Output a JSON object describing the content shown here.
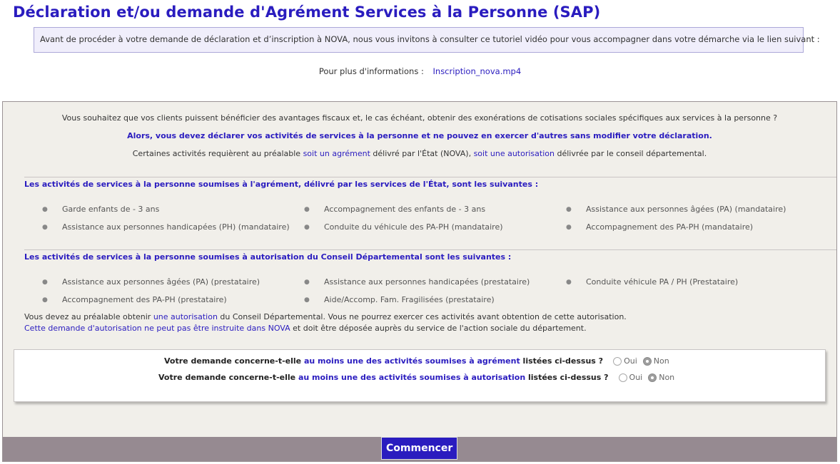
{
  "header": {
    "title": "Déclaration et/ou demande d'Agrément Services à la Personne (SAP)"
  },
  "tutorial": {
    "text": "Avant de procéder à votre demande de déclaration et d’inscription à NOVA, nous vous invitons à consulter ce tutoriel vidéo pour vous accompagner dans votre démarche via le lien suivant :"
  },
  "info": {
    "label": "Pour plus d'informations :",
    "link": "Inscription_nova.mp4"
  },
  "intro": {
    "line1": "Vous souhaitez que vos clients puissent bénéficier des avantages fiscaux et, le cas échéant, obtenir des exonérations de cotisations sociales spécifiques aux services à la personne ?",
    "line2": "Alors, vous devez déclarer vos activités de services à la personne et ne pouvez en exercer d'autres sans modifier votre déclaration.",
    "line3_a": "Certaines activités requièrent au préalable ",
    "line3_link1": "soit un agrément",
    "line3_b": " délivré par l'État (NOVA), ",
    "line3_link2": "soit une autorisation",
    "line3_c": " délivrée par le conseil départemental."
  },
  "agrement": {
    "title": "Les activités de services à la personne soumises à l'agrément, délivré par les services de l'État, sont les suivantes :",
    "items": [
      "Garde enfants de - 3 ans",
      "Accompagnement des enfants de - 3 ans",
      "Assistance aux personnes âgées (PA) (mandataire)",
      "Assistance aux personnes handicapées (PH) (mandataire)",
      "Conduite du véhicule des PA-PH (mandataire)",
      "Accompagnement des PA-PH (mandataire)"
    ]
  },
  "autorisation": {
    "title": "Les activités de services à la personne soumises à autorisation du Conseil Départemental sont les suivantes :",
    "items": [
      "Assistance aux personnes âgées (PA) (prestataire)",
      "Assistance aux personnes handicapées (prestataire)",
      "Conduite véhicule PA / PH (Prestataire)",
      "Accompagnement des PA-PH (prestataire)",
      "Aide/Accomp. Fam. Fragilisées (prestataire)"
    ],
    "note1_a": "Vous devez au préalable obtenir ",
    "note1_link": "une autorisation",
    "note1_b": " du Conseil Départemental. Vous ne pourrez exercer ces activités avant obtention de cette autorisation.",
    "note2_link": "Cette demande d'autorisation ne peut pas être instruite dans NOVA",
    "note2_b": " et doit être déposée auprès du service de l'action sociale du département."
  },
  "questions": {
    "q1_a": "Votre demande concerne-t-elle ",
    "q1_link": "au moins une des activités soumises à agrément",
    "q1_b": " listées ci-dessus ?",
    "q2_a": "Votre demande concerne-t-elle ",
    "q2_link": "au moins une des activités soumises à autorisation",
    "q2_b": " listées ci-dessus ?",
    "yes_label": "Oui",
    "no_label": "Non",
    "q1_selected": "Non",
    "q2_selected": "Non"
  },
  "footer": {
    "start_label": "Commencer"
  },
  "colors": {
    "accent": "#2a1cbf",
    "panel_bg": "#f1efea",
    "footer_bg": "#968a91"
  }
}
